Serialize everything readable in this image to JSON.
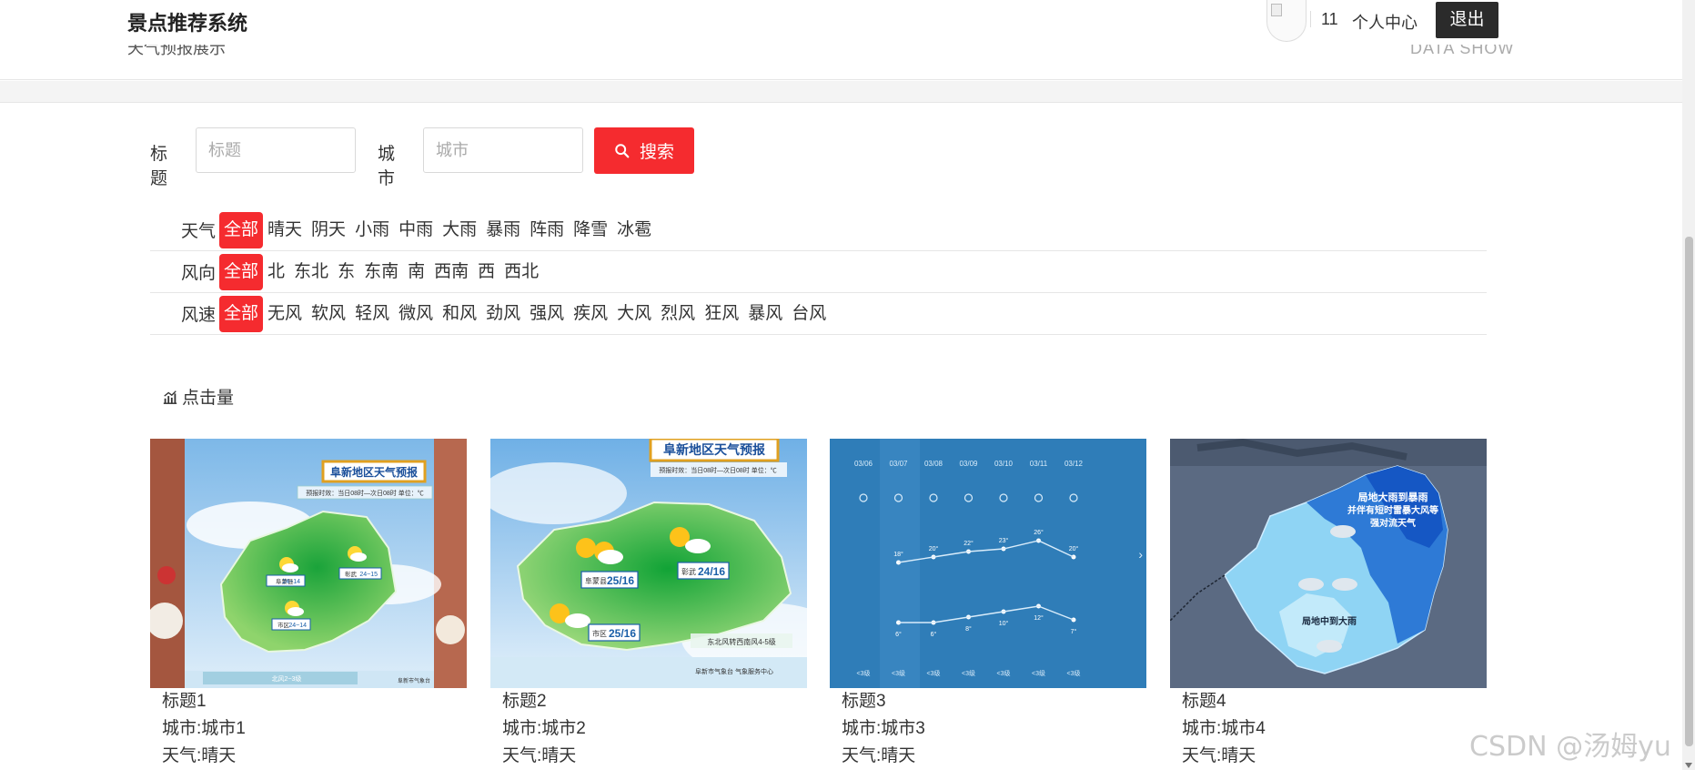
{
  "header": {
    "brand": "景点推荐系统",
    "crumb_left": "天气预报展示",
    "crumb_right": "DATA SHOW",
    "user_num": "11",
    "user_center": "个人中心",
    "logout": "退出"
  },
  "search": {
    "title_label": "标题",
    "title_placeholder": "标题",
    "city_label": "城市",
    "city_placeholder": "城市",
    "button_label": "搜索"
  },
  "filters": {
    "weather": {
      "label": "天气",
      "options": [
        "全部",
        "晴天",
        "阴天",
        "小雨",
        "中雨",
        "大雨",
        "暴雨",
        "阵雨",
        "降雪",
        "冰雹"
      ],
      "active": 0
    },
    "wind_dir": {
      "label": "风向",
      "options": [
        "全部",
        "北",
        "东北",
        "东",
        "东南",
        "南",
        "西南",
        "西",
        "西北"
      ],
      "active": 0
    },
    "wind_speed": {
      "label": "风速",
      "options": [
        "全部",
        "无风",
        "软风",
        "轻风",
        "微风",
        "和风",
        "劲风",
        "强风",
        "疾风",
        "大风",
        "烈风",
        "狂风",
        "暴风",
        "台风"
      ],
      "active": 0
    }
  },
  "section": {
    "title": "点击量"
  },
  "cards": [
    {
      "title": "标题1",
      "city": "城市:城市1",
      "weather": "天气:晴天"
    },
    {
      "title": "标题2",
      "city": "城市:城市2",
      "weather": "天气:晴天"
    },
    {
      "title": "标题3",
      "city": "城市:城市3",
      "weather": "天气:晴天"
    },
    {
      "title": "标题4",
      "city": "城市:城市4",
      "weather": "天气:晴天"
    }
  ],
  "card_images": {
    "img1": {
      "title": "阜新地区天气预报",
      "subtitle": "预报时效：当日08时—次日08时 单位：℃",
      "temps": [
        "24~14",
        "24~15",
        "24~14"
      ],
      "towns": [
        "阜蒙县",
        "彰武",
        "市区"
      ],
      "wind": "北风2~3级",
      "source": "阜新市气象台"
    },
    "img2": {
      "title": "阜新地区天气预报",
      "subtitle": "预报时效：当日08时—次日08时 单位：℃",
      "temps": [
        "25/16",
        "24/16",
        "25/16"
      ],
      "towns": [
        "阜蒙县",
        "彰武",
        "市区"
      ],
      "wind": "东北风转西南风4-5级",
      "source": "阜新市气象台 气象服务中心"
    },
    "img3": {
      "dates": [
        "03/06",
        "03/07",
        "03/08",
        "03/09",
        "03/10",
        "03/11",
        "03/12"
      ],
      "highs": [
        "18°",
        "20°",
        "22°",
        "23°",
        "26°",
        "20°"
      ],
      "lows": [
        "6°",
        "6°",
        "8°",
        "10°",
        "12°",
        "7°"
      ],
      "winds": [
        "<3级",
        "<3级",
        "<3级",
        "<3级",
        "<3级",
        "<3级",
        "<3级"
      ]
    },
    "img4": {
      "notes": [
        "局地大雨到暴雨",
        "并伴有短时雷暴大风等",
        "强对流天气",
        "局地中到大雨"
      ]
    }
  },
  "watermark": "CSDN @汤姆yu",
  "colors": {
    "accent": "#f52b2f",
    "logout_bg": "#2b2b2b"
  }
}
